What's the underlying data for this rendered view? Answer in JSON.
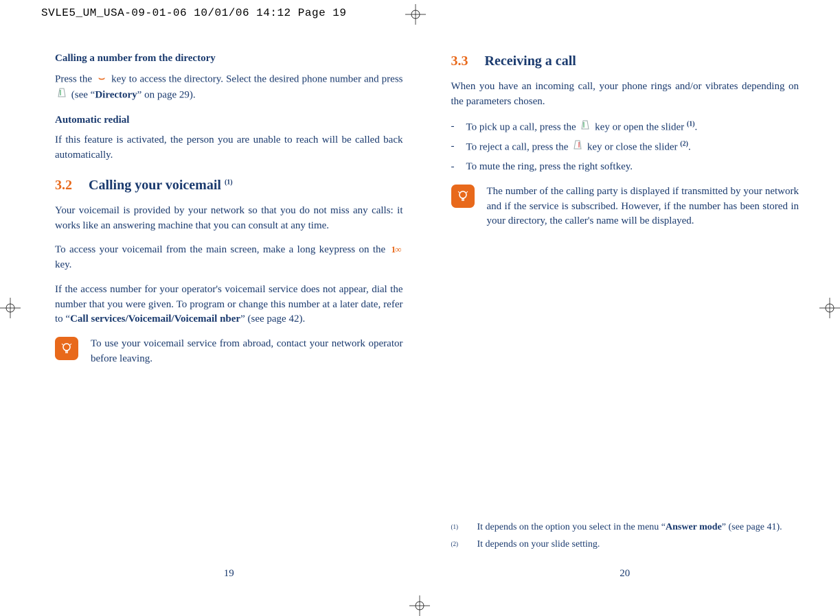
{
  "crop_header": "SVLE5_UM_USA-09-01-06  10/01/06  14:12  Page 19",
  "left": {
    "sub1": "Calling a number from the directory",
    "p1a": "Press  the ",
    "p1b": " key  to  access  the  directory.  Select  the  desired  phone number and press ",
    "p1c": " (see “",
    "p1_bold": "Directory",
    "p1d": "” on page 29).",
    "sub2": "Automatic redial",
    "p2": "If this feature is activated, the person you are unable to reach will be called back automatically.",
    "sec_num": "3.2",
    "sec_title": "Calling your voicemail ",
    "sec_sup": "(1)",
    "p3": "Your voicemail is provided by your network so that you do not miss any calls: it works like an answering machine that you can consult at any time.",
    "p4a": "To access your voicemail from the main screen, make a long keypress on the ",
    "p4b": " key.",
    "p5a": "If  the  access  number  for  your  operator's  voicemail  service  does  not appear, dial the number that you were given. To program or change this number  at  a  later  date,  refer  to  “",
    "p5_bold": "Call services/Voicemail/Voicemail nber",
    "p5b": "” (see page 42).",
    "tip": "To  use  your  voicemail  service  from  abroad,  contact  your network operator before leaving.",
    "pagenum": "19"
  },
  "right": {
    "sec_num": "3.3",
    "sec_title": "Receiving a call",
    "p1": "When  you  have  an  incoming  call,  your  phone  rings  and/or  vibrates depending on the parameters chosen.",
    "b1a": "To pick up a call, press the ",
    "b1b": " key or open the slider ",
    "b1sup": "(1)",
    "b1c": ".",
    "b2a": "To reject a call, press the ",
    "b2b": " key or close the slider ",
    "b2sup": "(2)",
    "b2c": ".",
    "b3": "To mute the ring, press the right softkey.",
    "tip": "The number of the calling party is displayed if transmitted by your network and if the service is subscribed. However, if the number has  been  stored  in  your  directory,  the  caller's  name  will  be displayed.",
    "fn1_marker": "(1)",
    "fn1a": "It depends on the option you select in the menu “",
    "fn1_bold": "Answer mode",
    "fn1b": "” (see page 41).",
    "fn2_marker": "(2)",
    "fn2": "It depends on your slide setting.",
    "pagenum": "20"
  },
  "icons": {
    "down_key": "⌣",
    "answer_key": "↿",
    "reject_key": "⇂",
    "one_key": "1∞",
    "bulb": "✦"
  }
}
